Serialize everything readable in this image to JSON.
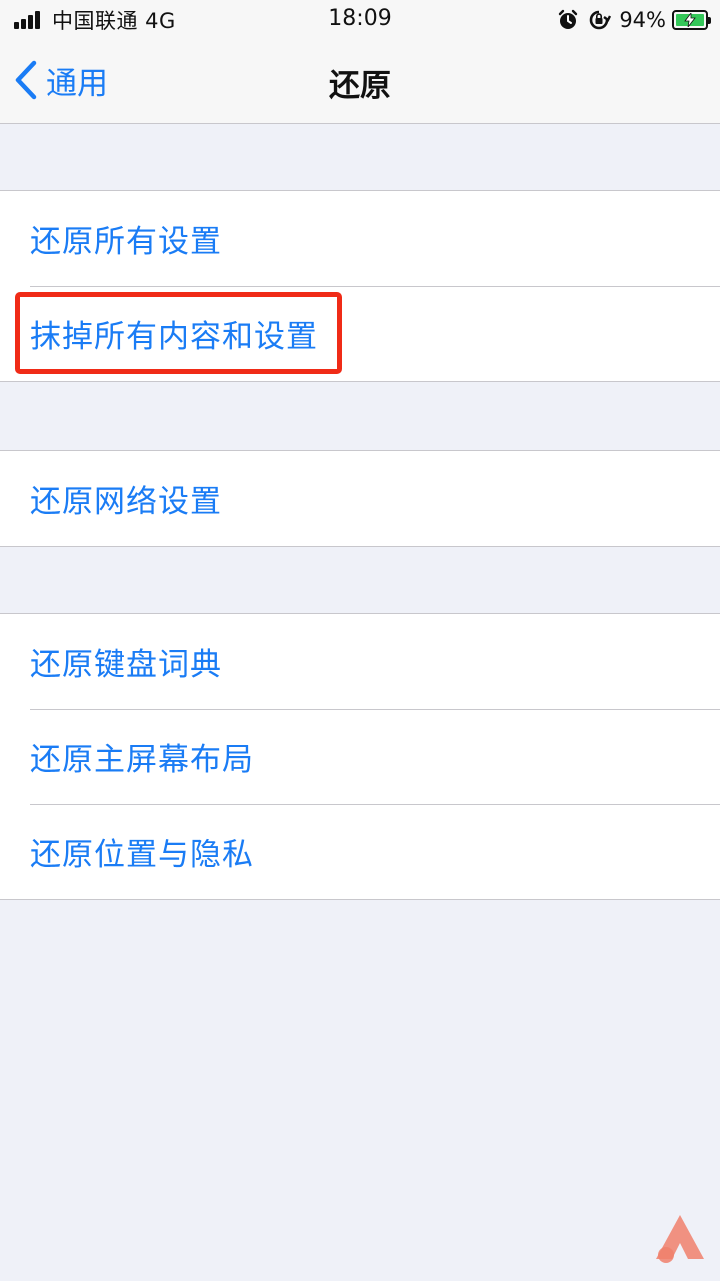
{
  "status_bar": {
    "carrier": "中国联通 4G",
    "time": "18:09",
    "battery_percent": "94%",
    "icons": [
      "signal-icon",
      "alarm-icon",
      "orientation-lock-icon",
      "battery-charging-icon"
    ]
  },
  "nav": {
    "back_label": "通用",
    "title": "还原"
  },
  "groups": [
    {
      "items": [
        "还原所有设置",
        "抹掉所有内容和设置"
      ]
    },
    {
      "items": [
        "还原网络设置"
      ]
    },
    {
      "items": [
        "还原键盘词典",
        "还原主屏幕布局",
        "还原位置与隐私"
      ]
    }
  ],
  "highlighted_item": "抹掉所有内容和设置",
  "colors": {
    "accent": "#1a7cf5",
    "highlight": "#f02b17",
    "background": "#eff1f8",
    "watermark": "#f0806c"
  }
}
